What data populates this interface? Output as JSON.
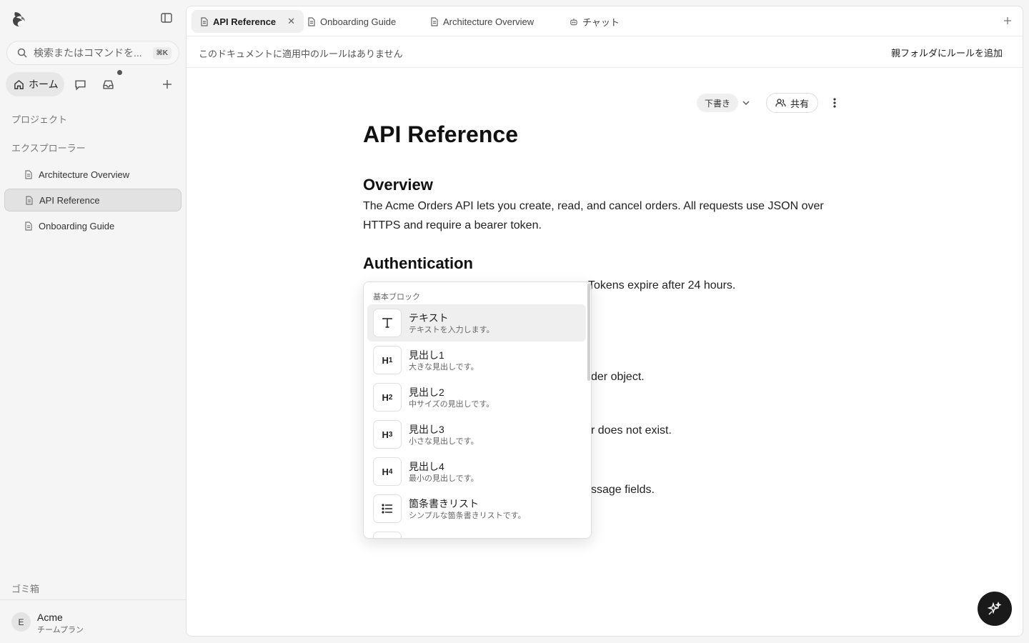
{
  "sidebar": {
    "search_placeholder": "検索またはコマンドを...",
    "search_shortcut": "⌘K",
    "home_label": "ホーム",
    "projects_label": "プロジェクト",
    "explorer_label": "エクスプローラー",
    "items": [
      {
        "label": "Architecture Overview",
        "active": false
      },
      {
        "label": "API Reference",
        "active": true
      },
      {
        "label": "Onboarding Guide",
        "active": false
      }
    ],
    "trash_label": "ゴミ箱",
    "org": {
      "initial": "E",
      "name": "Acme",
      "plan": "チームプラン"
    }
  },
  "tabs": [
    {
      "label": "API Reference",
      "active": true,
      "icon": "doc-icon"
    },
    {
      "label": "Onboarding Guide",
      "active": false,
      "icon": "doc-icon"
    },
    {
      "label": "Architecture Overview",
      "active": false,
      "icon": "doc-icon"
    },
    {
      "label": "チャット",
      "active": false,
      "icon": "bot-icon"
    }
  ],
  "rules_bar": {
    "message": "このドキュメントに適用中のルールはありません",
    "action": "親フォルダにルールを追加"
  },
  "doc_toolbar": {
    "status": "下書き",
    "share": "共有"
  },
  "document": {
    "title": "API Reference",
    "overview_heading": "Overview",
    "overview_line1": "The Acme Orders API lets you create, read, and cancel orders. All requests use JSON over",
    "overview_line2": "HTTPS and require a bearer token.",
    "auth_heading": "Authentication",
    "auth_visible_tail": "Tokens expire after 24 hours.",
    "frag1": "der object.",
    "frag2": "r does not exist.",
    "frag3": "ssage fields."
  },
  "slash_menu": {
    "section": "基本ブロック",
    "items": [
      {
        "icon": "T",
        "label": "テキスト",
        "desc": "テキストを入力します。",
        "selected": true
      },
      {
        "icon": "H1",
        "label": "見出し1",
        "desc": "大きな見出しです。",
        "selected": false
      },
      {
        "icon": "H2",
        "label": "見出し2",
        "desc": "中サイズの見出しです。",
        "selected": false
      },
      {
        "icon": "H3",
        "label": "見出し3",
        "desc": "小さな見出しです。",
        "selected": false
      },
      {
        "icon": "H4",
        "label": "見出し4",
        "desc": "最小の見出しです。",
        "selected": false
      },
      {
        "icon": "list",
        "label": "箇条書きリスト",
        "desc": "シンプルな箇条書きリストです。",
        "selected": false
      }
    ]
  }
}
